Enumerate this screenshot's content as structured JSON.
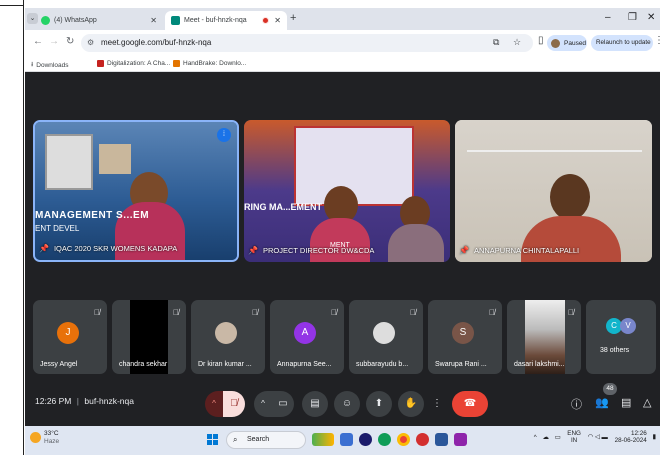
{
  "tabs": [
    {
      "title": "(4) WhatsApp",
      "active": false
    },
    {
      "title": "Meet - buf-hnzk-nqa",
      "active": true
    }
  ],
  "toolbar": {
    "url": "meet.google.com/buf-hnzk-nqa",
    "paused_label": "Paused",
    "relaunch_label": "Relaunch to update"
  },
  "bookmarks": [
    {
      "label": "Downloads"
    },
    {
      "label": "Digitalization: A Cha..."
    },
    {
      "label": "HandBrake: Downlo..."
    }
  ],
  "meet": {
    "featured": [
      {
        "name": "IQAC 2020 SKR WOMENS KADAPA",
        "banner": "MANAGEMENT S...EM",
        "banner_sub": "ENT DEVEL"
      },
      {
        "name": "PROJECT DIRECTOR DW&CDA",
        "banner": "RING MA...EMENT SYSTE",
        "banner_sub": "MENT"
      },
      {
        "name": "ANNAPURNA CHINTALAPALLI"
      }
    ],
    "participants": [
      {
        "name": "Jessy Angel",
        "initial": "J",
        "color": "#e8710a",
        "kind": "avatar"
      },
      {
        "name": "chandra sekhar",
        "kind": "video-black"
      },
      {
        "name": "Dr kiran kumar ...",
        "kind": "photo"
      },
      {
        "name": "Annapurna See...",
        "initial": "A",
        "color": "#9334e6",
        "kind": "avatar"
      },
      {
        "name": "subbarayudu b...",
        "kind": "photo"
      },
      {
        "name": "Swarupa Rani ...",
        "initial": "S",
        "color": "#795548",
        "kind": "avatar"
      },
      {
        "name": "dasari lakshmi...",
        "kind": "video"
      },
      {
        "name": "38 others",
        "kind": "others",
        "initials": [
          "C",
          "V"
        ]
      }
    ],
    "time": "12:26 PM",
    "meeting_code": "buf-hnzk-nqa",
    "people_count": "48"
  },
  "taskbar": {
    "temperature": "33°C",
    "weather": "Haze",
    "search_label": "Search",
    "lang": "ENG",
    "region": "IN",
    "clock_time": "12:26",
    "clock_date": "28-06-2024"
  }
}
